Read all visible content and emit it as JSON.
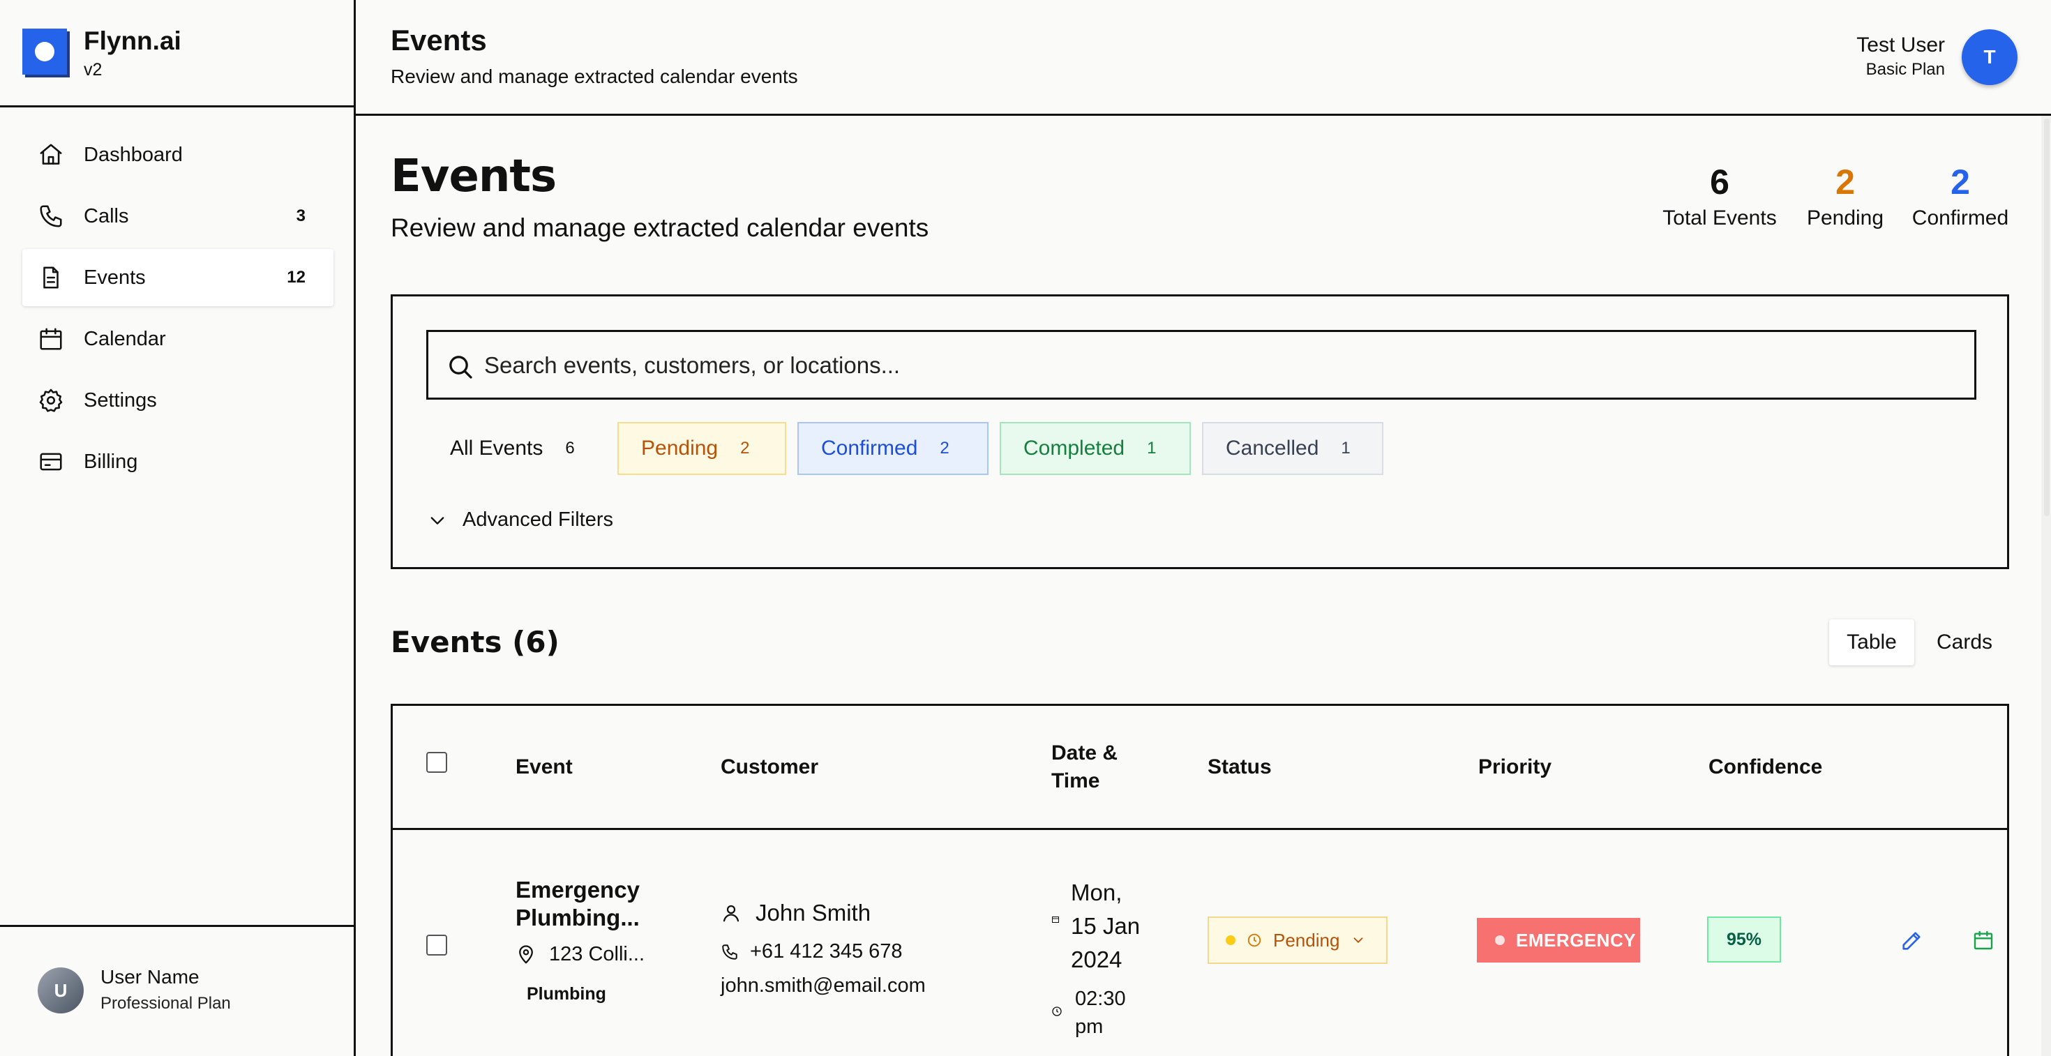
{
  "app": {
    "name": "Flynn.ai",
    "version": "v2"
  },
  "sidebar": {
    "items": [
      {
        "label": "Dashboard",
        "count": "",
        "icon": "home-icon"
      },
      {
        "label": "Calls",
        "count": "3",
        "icon": "phone-icon"
      },
      {
        "label": "Events",
        "count": "12",
        "icon": "document-icon",
        "active": true
      },
      {
        "label": "Calendar",
        "count": "",
        "icon": "calendar-icon"
      },
      {
        "label": "Settings",
        "count": "",
        "icon": "gear-icon"
      },
      {
        "label": "Billing",
        "count": "",
        "icon": "credit-card-icon"
      }
    ],
    "user": {
      "initial": "U",
      "name": "User Name",
      "plan": "Professional Plan"
    }
  },
  "topbar": {
    "title": "Events",
    "subtitle": "Review and manage extracted calendar events",
    "user": {
      "name": "Test User",
      "plan": "Basic Plan",
      "initial": "T"
    }
  },
  "page": {
    "title": "Events",
    "subtitle": "Review and manage extracted calendar events",
    "stats": [
      {
        "value": "6",
        "label": "Total Events",
        "color": "#111111"
      },
      {
        "value": "2",
        "label": "Pending",
        "color": "#d97706"
      },
      {
        "value": "2",
        "label": "Confirmed",
        "color": "#2563eb"
      }
    ]
  },
  "filters": {
    "search_placeholder": "Search events, customers, or locations...",
    "chips": [
      {
        "label": "All Events",
        "count": "6"
      },
      {
        "label": "Pending",
        "count": "2"
      },
      {
        "label": "Confirmed",
        "count": "2"
      },
      {
        "label": "Completed",
        "count": "1"
      },
      {
        "label": "Cancelled",
        "count": "1"
      }
    ],
    "advanced_label": "Advanced Filters"
  },
  "list": {
    "title": "Events (6)",
    "view_toggle": {
      "table": "Table",
      "cards": "Cards",
      "selected": "Table"
    },
    "columns": [
      "Event",
      "Customer",
      "Date &",
      "Time",
      "Status",
      "Priority",
      "Confidence"
    ],
    "rows": [
      {
        "event_title_line1": "Emergency",
        "event_title_line2": "Plumbing...",
        "location": "123 Colli...",
        "tag": "Plumbing",
        "customer_name": "John Smith",
        "phone": "+61 412 345 678",
        "email": "john.smith@email.com",
        "date_line1": "Mon,",
        "date_line2": "15 Jan",
        "date_line3": "2024",
        "time_line1": "02:30",
        "time_line2": "pm",
        "status": "Pending",
        "priority": "EMERGENCY",
        "confidence": "95%"
      }
    ]
  }
}
